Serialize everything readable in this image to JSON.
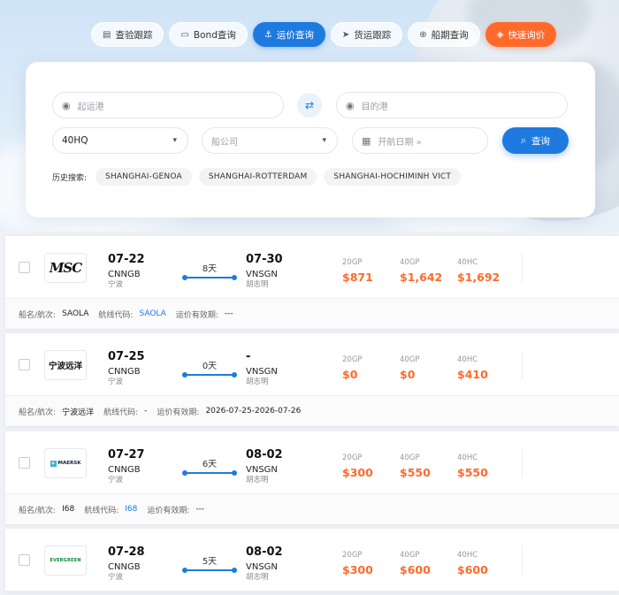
{
  "nav": [
    {
      "label": "查验跟踪",
      "icon": "clipboard-icon",
      "state": "default"
    },
    {
      "label": "Bond查询",
      "icon": "document-icon",
      "state": "default"
    },
    {
      "label": "运价查询",
      "icon": "anchor-icon",
      "state": "active"
    },
    {
      "label": "货运跟踪",
      "icon": "send-icon",
      "state": "default"
    },
    {
      "label": "船期查询",
      "icon": "globe-icon",
      "state": "default"
    },
    {
      "label": "快速询价",
      "icon": "box-icon",
      "state": "highlight"
    }
  ],
  "search": {
    "origin_placeholder": "起运港",
    "destination_placeholder": "目的港",
    "container_type": "40HQ",
    "carrier_placeholder": "船公司",
    "date_placeholder": "开航日期 »",
    "search_label": "查询",
    "history_label": "历史搜索:",
    "history": [
      "SHANGHAI-GENOA",
      "SHANGHAI-ROTTERDAM",
      "SHANGHAI-HOCHIMINH VICT"
    ]
  },
  "labels": {
    "vessel": "船名/航次:",
    "route_code": "航线代码:",
    "validity": "运价有效期:"
  },
  "colors": {
    "accent": "#1f7ae0",
    "price": "#ff6a2b"
  },
  "results": [
    {
      "carrier_logo": "MSC",
      "dep_date": "07-22",
      "dep_port": "CNNGB",
      "dep_city": "宁波",
      "duration": "8天",
      "arr_date": "07-30",
      "arr_port": "VNSGN",
      "arr_city": "胡志明",
      "prices": [
        {
          "type": "20GP",
          "value": "$871"
        },
        {
          "type": "40GP",
          "value": "$1,642"
        },
        {
          "type": "40HC",
          "value": "$1,692"
        }
      ],
      "vessel": "SAOLA",
      "route_code": "SAOLA",
      "validity": "---"
    },
    {
      "carrier_logo": "宁波远洋",
      "dep_date": "07-25",
      "dep_port": "CNNGB",
      "dep_city": "宁波",
      "duration": "0天",
      "arr_date": "-",
      "arr_port": "VNSGN",
      "arr_city": "胡志明",
      "prices": [
        {
          "type": "20GP",
          "value": "$0"
        },
        {
          "type": "40GP",
          "value": "$0"
        },
        {
          "type": "40HC",
          "value": "$410"
        }
      ],
      "vessel": "宁波远洋",
      "route_code": "-",
      "validity": "2026-07-25-2026-07-26"
    },
    {
      "carrier_logo": "MAERSK",
      "dep_date": "07-27",
      "dep_port": "CNNGB",
      "dep_city": "宁波",
      "duration": "6天",
      "arr_date": "08-02",
      "arr_port": "VNSGN",
      "arr_city": "胡志明",
      "prices": [
        {
          "type": "20GP",
          "value": "$300"
        },
        {
          "type": "40GP",
          "value": "$550"
        },
        {
          "type": "40HC",
          "value": "$550"
        }
      ],
      "vessel": "I68",
      "route_code": "I68",
      "validity": "---"
    },
    {
      "carrier_logo": "EVERGREEN",
      "dep_date": "07-28",
      "dep_port": "CNNGB",
      "dep_city": "宁波",
      "duration": "5天",
      "arr_date": "08-02",
      "arr_port": "VNSGN",
      "arr_city": "胡志明",
      "prices": [
        {
          "type": "20GP",
          "value": "$300"
        },
        {
          "type": "40GP",
          "value": "$600"
        },
        {
          "type": "40HC",
          "value": "$600"
        }
      ]
    }
  ]
}
